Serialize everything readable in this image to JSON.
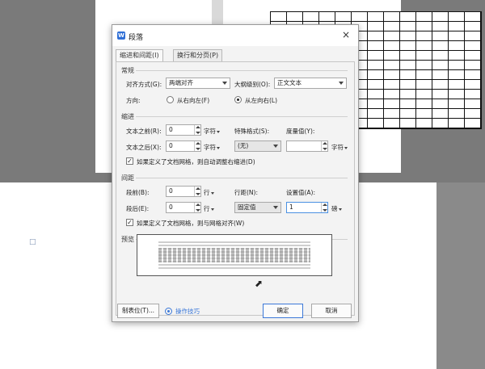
{
  "dialog": {
    "title": "段落",
    "logo_text": "W",
    "close_glyph": "×"
  },
  "tabs": [
    {
      "label": "缩进和间距(I)",
      "active": true
    },
    {
      "label": "换行和分页(P)",
      "active": false
    }
  ],
  "general": {
    "title": "常规",
    "alignment_label": "对齐方式(G):",
    "alignment_value": "两端对齐",
    "outline_label": "大纲级别(O):",
    "outline_value": "正文文本",
    "direction_label": "方向:",
    "direction_rtl": "从右向左(F)",
    "direction_ltr": "从左向右(L)",
    "direction_selected": "ltr"
  },
  "indent": {
    "title": "缩进",
    "before_label": "文本之前(R):",
    "before_value": "0",
    "before_unit": "字符",
    "after_label": "文本之后(X):",
    "after_value": "0",
    "after_unit": "字符",
    "special_label": "特殊格式(S):",
    "special_value": "(无)",
    "measure_label": "度量值(Y):",
    "measure_value": "",
    "measure_unit": "字符",
    "auto_adjust_label": "如果定义了文档网格，则自动调整右缩进(D)",
    "auto_adjust_checked": true
  },
  "spacing": {
    "title": "间距",
    "before_label": "段前(B):",
    "before_value": "0",
    "before_unit": "行",
    "after_label": "段后(E):",
    "after_value": "0",
    "after_unit": "行",
    "line_label": "行距(N):",
    "line_value": "固定值",
    "set_label": "设置值(A):",
    "set_value": "1",
    "set_unit": "磅",
    "snap_grid_label": "如果定义了文档网格，则与网格对齐(W)",
    "snap_grid_checked": true
  },
  "preview": {
    "title": "预览"
  },
  "footer": {
    "tabs_button": "制表位(T)...",
    "tips_link": "操作技巧",
    "ok_button": "确定",
    "cancel_button": "取消"
  },
  "icons": {
    "close": "close-icon",
    "logo": "wps-logo-icon",
    "cursor": "mouse-cursor-icon",
    "tips": "tips-icon",
    "page": "page-icon"
  },
  "colors": {
    "accent": "#3b78d8",
    "dialog_bg": "#f3f3f3"
  }
}
